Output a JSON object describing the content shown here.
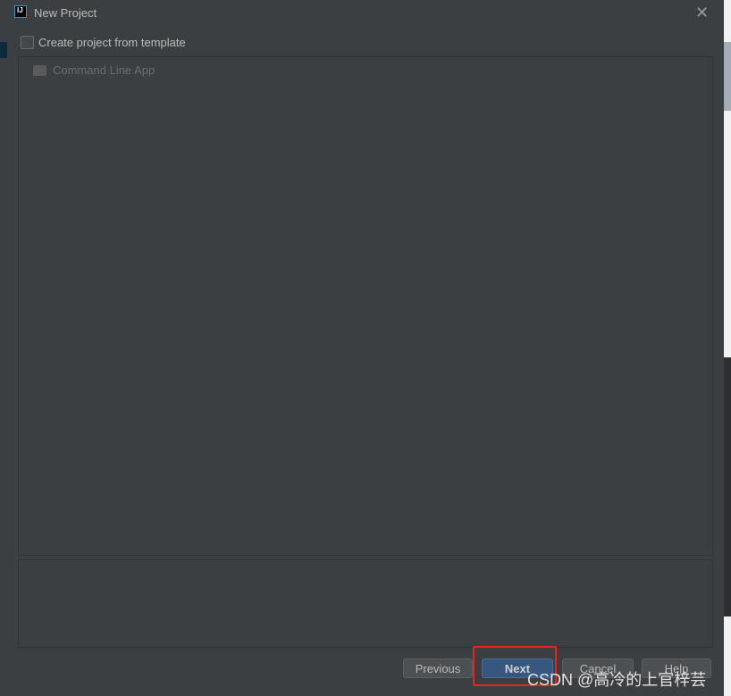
{
  "dialog": {
    "title": "New Project",
    "icon": "intellij-logo-icon",
    "logo_text": "IJ"
  },
  "template_checkbox": {
    "label": "Create project from template",
    "checked": false
  },
  "templates": [
    {
      "label": "Command Line App",
      "icon": "folder-icon"
    }
  ],
  "buttons": {
    "previous": "Previous",
    "next": "Next",
    "cancel": "Cancel",
    "help": "Help"
  },
  "watermark": "CSDN @高冷的上官梓芸",
  "colors": {
    "highlight": "#e8231c",
    "primary": "#365880"
  }
}
